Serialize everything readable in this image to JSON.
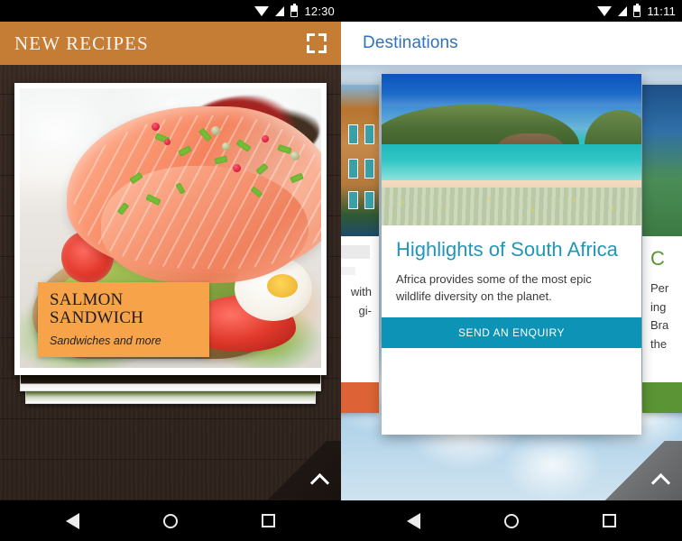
{
  "left_phone": {
    "status_bar": {
      "time": "12:30",
      "icons": [
        "wifi-icon",
        "signal-icon",
        "battery-icon"
      ]
    },
    "toolbar": {
      "title": "NEW RECIPES",
      "action_icon": "expand-fullscreen-icon",
      "background": "#c57c35"
    },
    "card": {
      "photo_alt": "salmon-sandwich-photo",
      "label": {
        "title_line1": "SALMON",
        "title_line2": "SANDWICH",
        "subtitle": "Sandwiches and more",
        "background": "#f7a34a"
      }
    },
    "fab": {
      "icon": "chevron-up-icon"
    },
    "nav_bar": {
      "back": "back-triangle-icon",
      "home": "home-circle-icon",
      "recents": "recents-square-icon"
    }
  },
  "right_phone": {
    "status_bar": {
      "time": "11:11",
      "icons": [
        "wifi-icon",
        "signal-icon",
        "battery-icon"
      ]
    },
    "toolbar": {
      "title": "Destinations",
      "title_color": "#2f72bd"
    },
    "carousel": {
      "left_card": {
        "desc_line1": "with",
        "desc_line2": "gi-",
        "cta_color": "#dd6336",
        "photo_alt": "venice-building-photo"
      },
      "center_card": {
        "title": "Highlights of South Africa",
        "title_color": "#2196b9",
        "description": "Africa provides some of the most epic wildlife diversity on the planet.",
        "cta_label": "SEND AN ENQUIRY",
        "cta_color": "#0c93b5",
        "photo_alt": "south-africa-lagoon-beach-photo"
      },
      "right_card": {
        "title": "C",
        "desc_line1": "Per",
        "desc_line2": "ing",
        "desc_line3": "Bra",
        "desc_line4": "the",
        "title_color": "#5b9434",
        "cta_color": "#5b9434",
        "photo_alt": "landscape-photo"
      }
    },
    "fab": {
      "icon": "chevron-up-icon"
    },
    "nav_bar": {
      "back": "back-triangle-icon",
      "home": "home-circle-icon",
      "recents": "recents-square-icon"
    }
  }
}
